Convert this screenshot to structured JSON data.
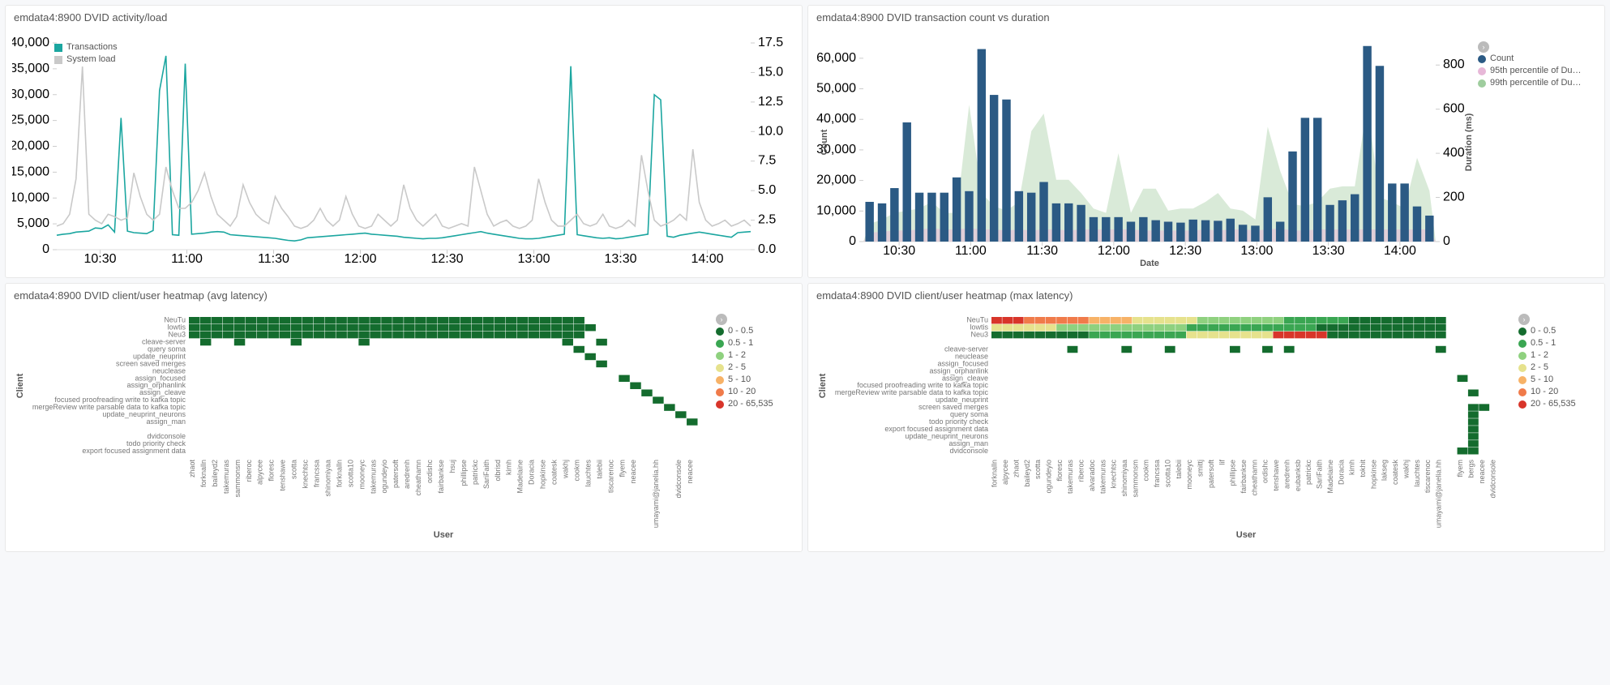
{
  "panels": {
    "activity": {
      "title": "emdata4:8900 DVID activity/load",
      "legend_items": [
        "Transactions",
        "System load"
      ]
    },
    "txn": {
      "title": "emdata4:8900 DVID transaction count vs duration",
      "axis_y1": "Count",
      "axis_y2": "Duration (ms)",
      "axis_x": "Date",
      "legend_items": [
        "Count",
        "95th percentile of Du…",
        "99th percentile of Du…"
      ]
    },
    "heat_avg": {
      "title": "emdata4:8900 DVID client/user heatmap (avg latency)",
      "axis_y": "Client",
      "axis_x": "User"
    },
    "heat_max": {
      "title": "emdata4:8900 DVID client/user heatmap (max latency)",
      "axis_y": "Client",
      "axis_x": "User"
    }
  },
  "legend_heat": [
    {
      "label": "0 - 0.5",
      "color": "#146c2e"
    },
    {
      "label": "0.5 - 1",
      "color": "#3aa652"
    },
    {
      "label": "1 - 2",
      "color": "#8fd17f"
    },
    {
      "label": "2 - 5",
      "color": "#e6e28d"
    },
    {
      "label": "5 - 10",
      "color": "#f7b267"
    },
    {
      "label": "10 - 20",
      "color": "#f07b4a"
    },
    {
      "label": "20 - 65,535",
      "color": "#d8352a"
    }
  ],
  "chart_data": [
    {
      "id": "activity",
      "type": "line",
      "title": "emdata4:8900 DVID activity/load",
      "x_ticks": [
        "10:30",
        "11:00",
        "11:30",
        "12:00",
        "12:30",
        "13:00",
        "13:30",
        "14:00"
      ],
      "y1": {
        "label": "Transactions",
        "ylim": [
          0,
          40000
        ],
        "ticks": [
          0,
          5000,
          10000,
          15000,
          20000,
          25000,
          30000,
          35000,
          40000
        ]
      },
      "y2": {
        "label": "System load",
        "ylim": [
          0,
          17.5
        ],
        "ticks": [
          0.0,
          2.5,
          5.0,
          7.5,
          10.0,
          12.5,
          15.0,
          17.5
        ]
      },
      "series": [
        {
          "name": "Transactions",
          "color": "#1ba6a0",
          "axis": "y1",
          "values": [
            2800,
            3000,
            3100,
            3400,
            3500,
            3600,
            4200,
            4100,
            4800,
            3400,
            25500,
            3600,
            3300,
            3200,
            3100,
            3700,
            30800,
            37500,
            2900,
            2800,
            36000,
            3000,
            3100,
            3200,
            3400,
            3500,
            3400,
            2900,
            2800,
            2700,
            2600,
            2500,
            2400,
            2300,
            2200,
            2000,
            1800,
            1700,
            1900,
            2300,
            2400,
            2500,
            2600,
            2700,
            2800,
            2900,
            3000,
            3100,
            3200,
            3000,
            2900,
            2800,
            2700,
            2600,
            2400,
            2300,
            2200,
            2100,
            2200,
            2200,
            2300,
            2500,
            2700,
            2900,
            3100,
            3300,
            3500,
            3200,
            3000,
            2800,
            2600,
            2400,
            2200,
            2100,
            2100,
            2200,
            2400,
            2600,
            2800,
            3000,
            35500,
            2900,
            2700,
            2500,
            2300,
            2200,
            2300,
            2100,
            2200,
            2400,
            2600,
            2800,
            3000,
            30000,
            29000,
            2600,
            2400,
            2800,
            3000,
            3200,
            3400,
            3200,
            3000,
            2800,
            2600,
            2400,
            3300,
            3400,
            3500
          ]
        },
        {
          "name": "System load",
          "color": "#c9c9c9",
          "axis": "y2",
          "values": [
            2.0,
            2.2,
            3.0,
            6.0,
            15.5,
            3.0,
            2.5,
            2.2,
            3.0,
            2.8,
            2.5,
            2.7,
            6.5,
            4.5,
            3.0,
            2.5,
            3.0,
            7.0,
            5.0,
            3.5,
            3.5,
            4.0,
            5.0,
            6.5,
            4.5,
            3.0,
            2.5,
            2.0,
            2.8,
            5.5,
            4.0,
            3.0,
            2.5,
            2.2,
            4.5,
            3.5,
            2.8,
            2.0,
            1.8,
            2.0,
            2.5,
            3.5,
            2.5,
            2.0,
            2.5,
            4.5,
            3.0,
            2.0,
            1.8,
            2.0,
            3.0,
            2.5,
            2.0,
            2.5,
            5.5,
            3.5,
            2.5,
            2.0,
            2.5,
            3.0,
            2.0,
            1.8,
            2.0,
            2.2,
            2.0,
            7.0,
            5.0,
            3.0,
            2.0,
            2.3,
            2.5,
            2.0,
            1.8,
            2.0,
            2.5,
            6.0,
            4.0,
            2.5,
            2.0,
            2.0,
            2.5,
            3.0,
            2.2,
            2.0,
            2.2,
            3.0,
            2.0,
            1.8,
            2.0,
            2.5,
            2.0,
            8.0,
            5.0,
            2.5,
            2.0,
            2.2,
            2.5,
            3.0,
            2.5,
            8.5,
            4.0,
            2.5,
            2.0,
            2.2,
            2.5,
            2.0,
            2.2,
            2.5,
            2.0
          ]
        }
      ]
    },
    {
      "id": "txn",
      "type": "bar+area",
      "title": "emdata4:8900 DVID transaction count vs duration",
      "xlabel": "Date",
      "y1label": "Count",
      "y2label": "Duration (ms)",
      "x_ticks": [
        "10:30",
        "11:00",
        "11:30",
        "12:00",
        "12:30",
        "13:00",
        "13:30",
        "14:00"
      ],
      "y1": {
        "ylim": [
          0,
          65000
        ],
        "ticks": [
          0,
          10000,
          20000,
          30000,
          40000,
          50000,
          60000
        ]
      },
      "y2": {
        "ylim": [
          0,
          900
        ],
        "ticks": [
          0,
          200,
          400,
          600,
          800
        ]
      },
      "series": [
        {
          "name": "Count",
          "type": "bar",
          "color": "#2b5a84",
          "values": [
            13000,
            12500,
            17500,
            39000,
            16000,
            16000,
            16000,
            21000,
            16500,
            63000,
            48000,
            46500,
            16500,
            16000,
            19500,
            12500,
            12500,
            12000,
            8000,
            8000,
            8000,
            6500,
            8000,
            7000,
            6500,
            6200,
            7200,
            7000,
            6800,
            7500,
            5500,
            5200,
            14500,
            6500,
            29500,
            40500,
            40500,
            12000,
            13500,
            15500,
            64000,
            57500,
            19000,
            19000,
            11500,
            8500
          ]
        },
        {
          "name": "95th percentile of Duration",
          "type": "area",
          "color": "#e7b8d8",
          "values": [
            40,
            45,
            50,
            50,
            55,
            60,
            55,
            55,
            60,
            55,
            55,
            50,
            55,
            50,
            55,
            55,
            50,
            55,
            55,
            55,
            55,
            55,
            50,
            50,
            50,
            50,
            50,
            55,
            50,
            55,
            55,
            50,
            55,
            60,
            50,
            50,
            55,
            55,
            55,
            55,
            55,
            55,
            55,
            55,
            55,
            55
          ]
        },
        {
          "name": "99th percentile of Duration",
          "type": "area",
          "color": "#b9d9b8",
          "values": [
            80,
            100,
            130,
            140,
            150,
            180,
            130,
            130,
            620,
            220,
            160,
            140,
            180,
            500,
            580,
            280,
            280,
            220,
            150,
            130,
            400,
            130,
            240,
            240,
            140,
            150,
            150,
            180,
            220,
            150,
            140,
            100,
            520,
            320,
            170,
            160,
            180,
            240,
            250,
            250,
            620,
            200,
            180,
            150,
            380,
            230
          ]
        }
      ]
    },
    {
      "id": "heat_avg",
      "type": "heatmap",
      "title": "emdata4:8900 DVID client/user heatmap (avg latency)",
      "xlabel": "User",
      "ylabel": "Client",
      "y_categories": [
        "NeuTu",
        "lowtis",
        "Neu3",
        "cleave-server",
        "query soma",
        "update_neuprint",
        "screen saved merges",
        "neuclease",
        "assign_focused",
        "assign_orphanlink",
        "assign_cleave",
        "focused proofreading write to kafka topic",
        "mergeReview write parsable data to kafka topic",
        "update_neuprint_neurons",
        "assign_man",
        "",
        "dvidconsole",
        "todo priority check",
        "export focused assignment data"
      ],
      "x_categories": [
        "zhaot",
        "forknalln",
        "baileyd2",
        "takemuras",
        "sammonsm",
        "riberoc",
        "alpycee",
        "floresc",
        "tenshawe",
        "scotta",
        "knechtsc",
        "francssa",
        "shinomiyaa",
        "forknalln",
        "scotta10",
        "mooneyc",
        "takemuras",
        "ogundeyio",
        "patersoft",
        "aredrenh",
        "cheathamn",
        "ordishc",
        "fairbankse",
        "hsuj",
        "phillipse",
        "patrickc",
        "SariFaith",
        "olbrisd",
        "kimh",
        "Madelaine",
        "Doracia",
        "hopkinse",
        "coatesk",
        "wakhj",
        "cookm",
        "lauchtes",
        "talebii",
        "tiscarenoc",
        "flyem",
        "neacee",
        "",
        "umayami@janelia.hh",
        "",
        "dvidconsole",
        "neacee"
      ],
      "color_scale": [
        {
          "min": 0,
          "max": 0.5,
          "c": "#146c2e"
        },
        {
          "min": 0.5,
          "max": 1,
          "c": "#3aa652"
        },
        {
          "min": 1,
          "max": 2,
          "c": "#8fd17f"
        },
        {
          "min": 2,
          "max": 5,
          "c": "#e6e28d"
        },
        {
          "min": 5,
          "max": 10,
          "c": "#f7b267"
        },
        {
          "min": 10,
          "max": 20,
          "c": "#f07b4a"
        },
        {
          "min": 20,
          "max": 65535,
          "c": "#d8352a"
        }
      ],
      "cells_note": "Nearly all populated cells in rows NeuTu/lowtis/Neu3 fall in 0-0.5; sparse green cells appear in lower rows aligned to rightmost users."
    },
    {
      "id": "heat_max",
      "type": "heatmap",
      "title": "emdata4:8900 DVID client/user heatmap (max latency)",
      "xlabel": "User",
      "ylabel": "Client",
      "y_categories": [
        "NeuTu",
        "lowtis",
        "Neu3",
        "",
        "cleave-server",
        "neuclease",
        "assign_focused",
        "assign_orphanlink",
        "assign_cleave",
        "focused proofreading write to kafka topic",
        "mergeReview write parsable data to kafka topic",
        "update_neuprint",
        "screen saved merges",
        "query soma",
        "todo priority check",
        "export focused assignment data",
        "update_neuprint_neurons",
        "assign_man",
        "dvidconsole"
      ],
      "x_categories": [
        "forknalln",
        "alpycee",
        "zhaot",
        "baileyd2",
        "scotta",
        "ogundeyio",
        "floresc",
        "takemuras",
        "riberoc",
        "alvaradoc",
        "takemuras",
        "knechtsc",
        "shinomiyaa",
        "sammonsm",
        "cookm",
        "francssa",
        "scotta10",
        "talebii",
        "mooneyc",
        "smittj",
        "patersoft",
        "lif",
        "phillipse",
        "fairbankse",
        "cheathamn",
        "ordishc",
        "tenshawe",
        "aredrenh",
        "eubanksb",
        "patrickc",
        "SariFaith",
        "Madelaine",
        "Doracia",
        "kimh",
        "tokhit",
        "hopkinse",
        "lakseg",
        "coatesk",
        "wakhj",
        "lauchtes",
        "tiscarenoc",
        "umayami@janelia.hh",
        "",
        "flyem",
        "bergs",
        "neacee",
        "dvidconsole"
      ],
      "color_scale": [
        {
          "min": 0,
          "max": 0.5,
          "c": "#146c2e"
        },
        {
          "min": 0.5,
          "max": 1,
          "c": "#3aa652"
        },
        {
          "min": 1,
          "max": 2,
          "c": "#8fd17f"
        },
        {
          "min": 2,
          "max": 5,
          "c": "#e6e28d"
        },
        {
          "min": 5,
          "max": 10,
          "c": "#f7b267"
        },
        {
          "min": 10,
          "max": 20,
          "c": "#f07b4a"
        },
        {
          "min": 20,
          "max": 65535,
          "c": "#d8352a"
        }
      ],
      "cells_note": "Row NeuTu starts red (20+) for first ~4 users then orange/yellow spectrum; lowtis mostly yellow/green; Neu3 green with yellow/orange midsection and red block near right; scattered dark-green cells in lower rows near right edge."
    }
  ]
}
